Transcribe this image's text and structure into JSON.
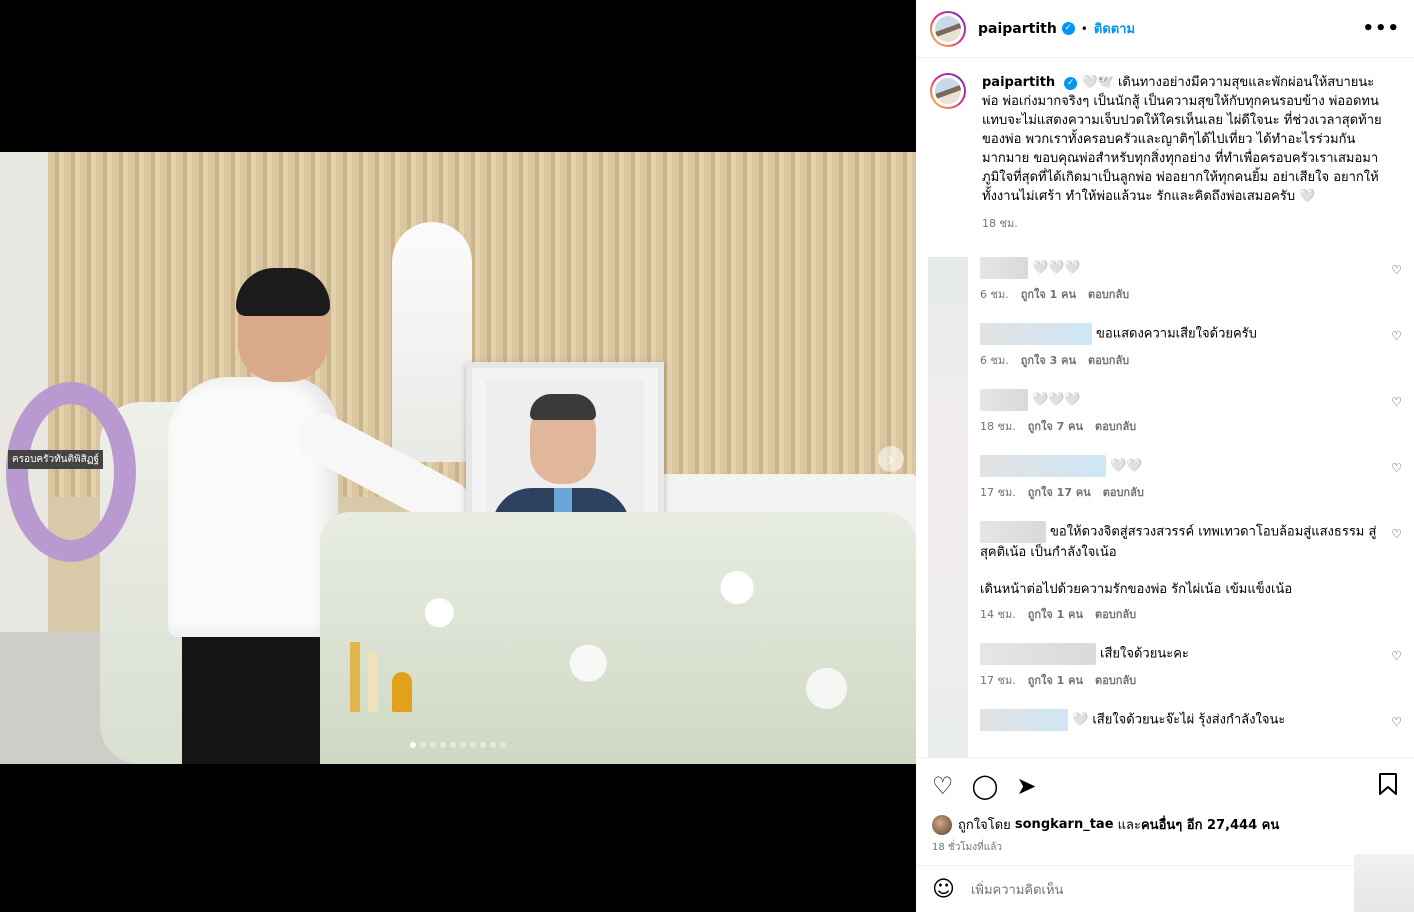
{
  "post": {
    "username": "paipartith",
    "follow_label": "ติดตาม",
    "separator": "•",
    "more_label": "•••"
  },
  "photo": {
    "wreath_text": "ครอบครัวทันติพิสิฏฐ์"
  },
  "caption": {
    "username": "paipartith",
    "text": "🤍🕊️ เดินทางอย่างมีความสุขและพักผ่อนให้สบายนะพ่อ พ่อเก่งมากจริงๆ เป็นนักสู้ เป็นความสุขให้กับทุกคนรอบข้าง พ่ออดทน แทบจะไม่แสดงความเจ็บปวดให้ใครเห็นเลย ไผ่ดีใจนะ ที่ช่วงเวลาสุดท้ายของพ่อ พวกเราทั้งครอบครัวและญาติๆได้ไปเที่ยว ได้ทำอะไรร่วมกันมากมาย ขอบคุณพ่อสำหรับทุกสิ่งทุกอย่าง ที่ทำเพื่อครอบครัวเราเสมอมา ภูมิใจที่สุดที่ได้เกิดมาเป็นลูกพ่อ พ่ออยากให้ทุกคนยิ้ม อย่าเสียใจ อยากให้ทั้งงานไม่เศร้า ทำให้พ่อแล้วนะ รักและคิดถึงพ่อเสมอครับ 🤍",
    "time": "18 ชม."
  },
  "comments": [
    {
      "text": "🤍🤍🤍",
      "time": "6 ชม.",
      "likes": "ถูกใจ 1 คน",
      "reply": "ตอบกลับ"
    },
    {
      "text": "ขอแสดงความเสียใจด้วยครับ",
      "time": "6 ชม.",
      "likes": "ถูกใจ 3 คน",
      "reply": "ตอบกลับ"
    },
    {
      "text": "🤍🤍🤍",
      "time": "18 ชม.",
      "likes": "ถูกใจ 7 คน",
      "reply": "ตอบกลับ"
    },
    {
      "text": "🤍🤍",
      "time": "17 ชม.",
      "likes": "ถูกใจ 17 คน",
      "reply": "ตอบกลับ"
    },
    {
      "text": "ขอให้ดวงจิตสู่สรวงสวรรค์ เทพเทวดาโอบล้อมสู่แสงธรรม สู่สุคติเน้อ เป็นกำลังใจเน้อ",
      "text2": "เดินหน้าต่อไปด้วยความรักของพ่อ รักไผ่เน้อ เข้มแข็งเน้อ",
      "time": "14 ชม.",
      "likes": "ถูกใจ 1 คน",
      "reply": "ตอบกลับ"
    },
    {
      "text": "เสียใจด้วยนะคะ",
      "time": "17 ชม.",
      "likes": "ถูกใจ 1 คน",
      "reply": "ตอบกลับ"
    },
    {
      "text": "🤍 เสียใจด้วยนะจ๊ะไผ่ รุ้งส่งกำลังใจนะ"
    }
  ],
  "likes": {
    "prefix": "ถูกใจโดย",
    "user": "songkarn_tae",
    "middle": "และ",
    "others": "คนอื่นๆ อีก 27,444 คน"
  },
  "post_time": "18 ชั่วโมงที่แล้ว",
  "add_comment_placeholder": "เพิ่มความคิดเห็น",
  "icons": {
    "heart": "heart-icon",
    "comment": "comment-icon",
    "share": "share-icon",
    "save": "bookmark-icon",
    "emoji": "emoji-icon",
    "next": "chevron-right-icon"
  },
  "colors": {
    "accent": "#0095f6",
    "muted": "#737373"
  }
}
